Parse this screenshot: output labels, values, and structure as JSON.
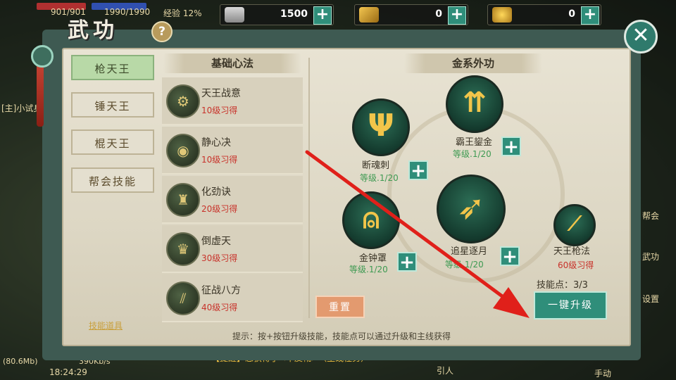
{
  "window": {
    "title": "武功",
    "help_label": "?",
    "close_label": "✕"
  },
  "top_bar": {
    "hp_text": "901/901",
    "mp_text": "1990/1990",
    "exp_text": "经验 12%",
    "resources": [
      {
        "icon": "silver-ingot-icon",
        "value": "1500"
      },
      {
        "icon": "gold-bar-icon",
        "value": "0"
      },
      {
        "icon": "gold-ingot-icon",
        "value": "0"
      }
    ],
    "plus_label": "+"
  },
  "tabs": [
    {
      "label": "枪天王",
      "active": true
    },
    {
      "label": "锤天王",
      "active": false
    },
    {
      "label": "棍天王",
      "active": false
    },
    {
      "label": "帮会技能",
      "active": false
    }
  ],
  "skill_items_link": "技能道具",
  "basic": {
    "header": "基础心法",
    "skills": [
      {
        "name": "天王战意",
        "requirement": "10级习得",
        "icon": "gears-icon"
      },
      {
        "name": "静心决",
        "requirement": "10级习得",
        "icon": "eye-icon"
      },
      {
        "name": "化劲诀",
        "requirement": "20级习得",
        "icon": "warrior-icon"
      },
      {
        "name": "倒虚天",
        "requirement": "30级习得",
        "icon": "armor-icon"
      },
      {
        "name": "征战八方",
        "requirement": "40级习得",
        "icon": "spears-icon"
      }
    ]
  },
  "gold": {
    "header": "金系外功",
    "skills": [
      {
        "name": "断魂刺",
        "level": "等级.1/20",
        "icon": "trident-icon"
      },
      {
        "name": "霸王鋆金",
        "level": "等级.1/20",
        "icon": "arrows-up-icon"
      },
      {
        "name": "金钟罩",
        "level": "等级.1/20",
        "icon": "bell-icon"
      },
      {
        "name": "追星逐月",
        "level": "等级.1/20",
        "icon": "spear-rush-icon"
      },
      {
        "name": "天王枪法",
        "requirement": "60级习得",
        "icon": "spear-icon"
      }
    ],
    "skill_points": "技能点：3/3",
    "reset_label": "重置",
    "upgrade_label": "一键升级"
  },
  "tip": "提示：按+按钮升级技能，技能点可以通过升级和主线获得",
  "background": {
    "chat_line": "【提醒】您获得了<牛皮靴>（主线任务）",
    "clock": "18:24:29",
    "fps": "(80.6Mb)",
    "net": "390Kb/s",
    "side_labels": [
      "[主]小试身",
      "帮会",
      "武功",
      "设置",
      "手动",
      "引人"
    ]
  },
  "colors": {
    "accent": "#2f8e7a",
    "requirement": "#c8322a",
    "level": "#3e9a52",
    "arrow": "#e0201a"
  }
}
